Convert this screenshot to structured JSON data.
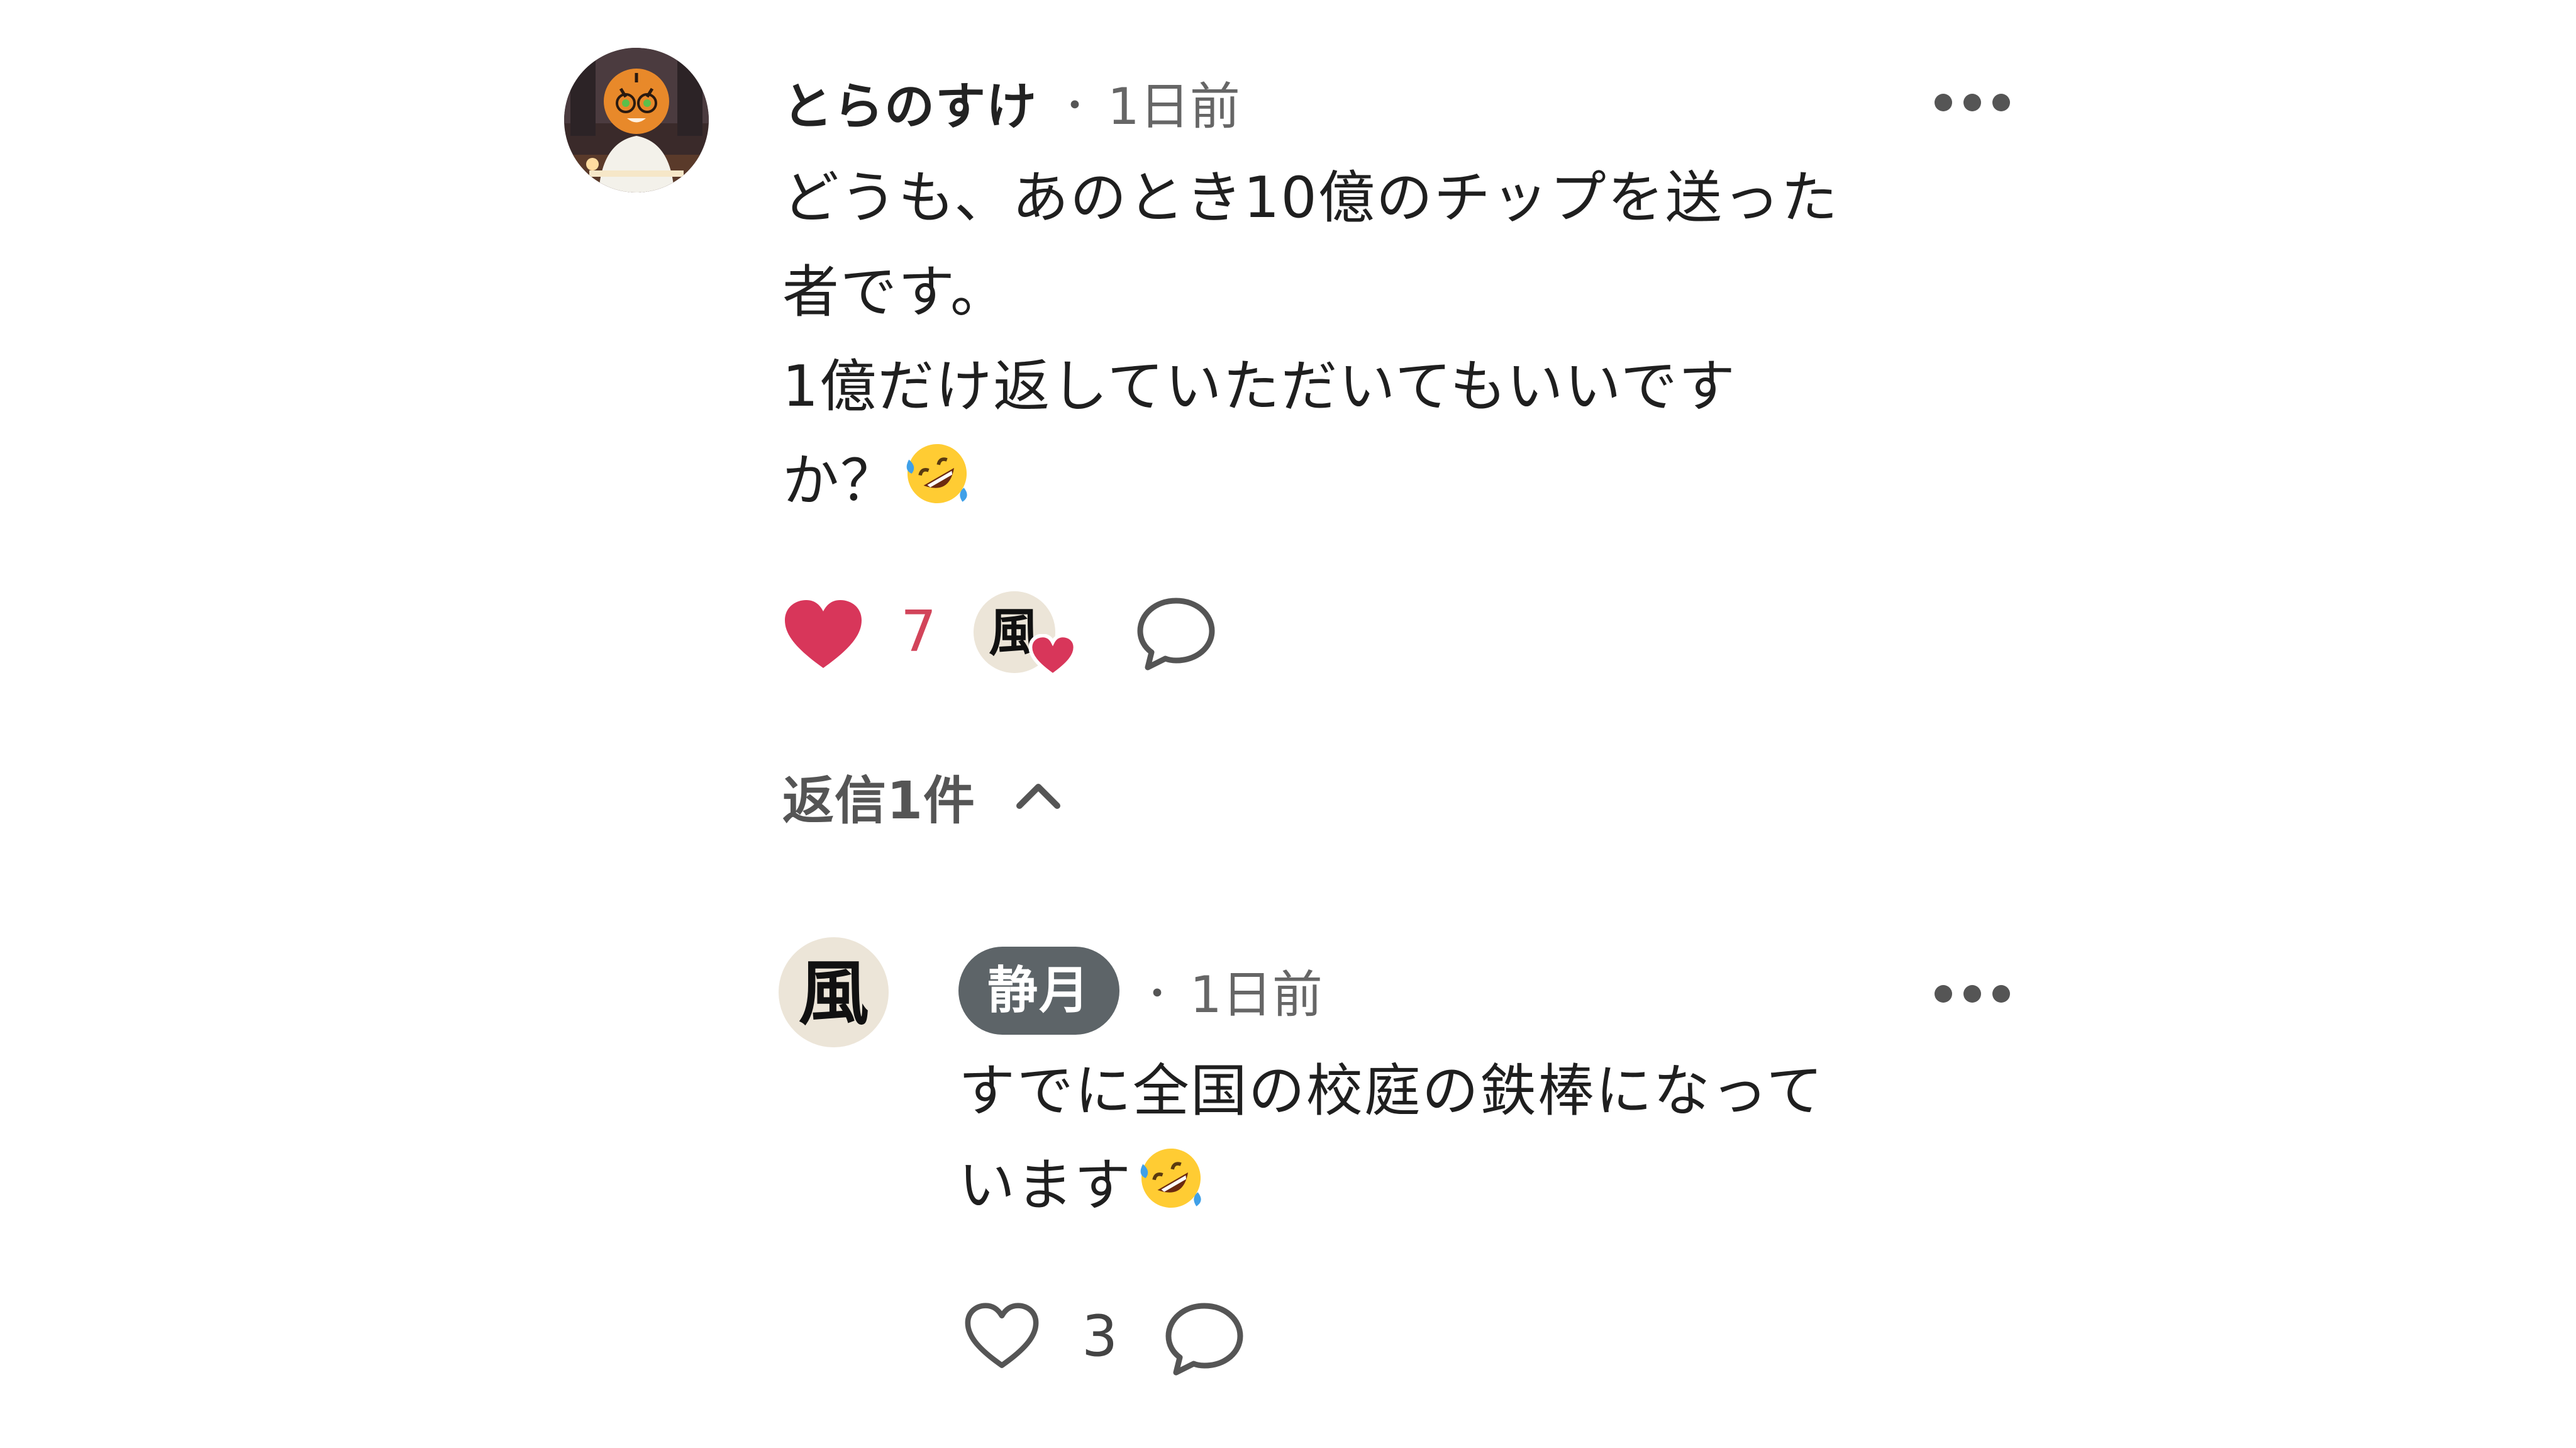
{
  "comment": {
    "username": "とらのすけ",
    "separator": "・",
    "time": "1日前",
    "body_lines": [
      "どうも、あのとき10億のチップを送った",
      "者です。",
      "1億だけ返していただいてもいいです",
      "か？"
    ],
    "emoji": "rolling-on-floor-laughing",
    "liked": true,
    "like_count": "7",
    "liker_avatar_glyph": "風",
    "replies_toggle_label": "返信1件",
    "replies_expanded": true
  },
  "reply": {
    "username": "静月",
    "separator": "・",
    "time": "1日前",
    "avatar_glyph": "風",
    "body_lines": [
      "すでに全国の校庭の鉄棒になって",
      "います"
    ],
    "emoji": "rolling-on-floor-laughing",
    "liked": false,
    "like_count": "3"
  },
  "colors": {
    "like_active": "#d8365a",
    "like_count_active": "#d2445a",
    "icon_gray": "#555555",
    "badge_bg": "#5d6468"
  }
}
